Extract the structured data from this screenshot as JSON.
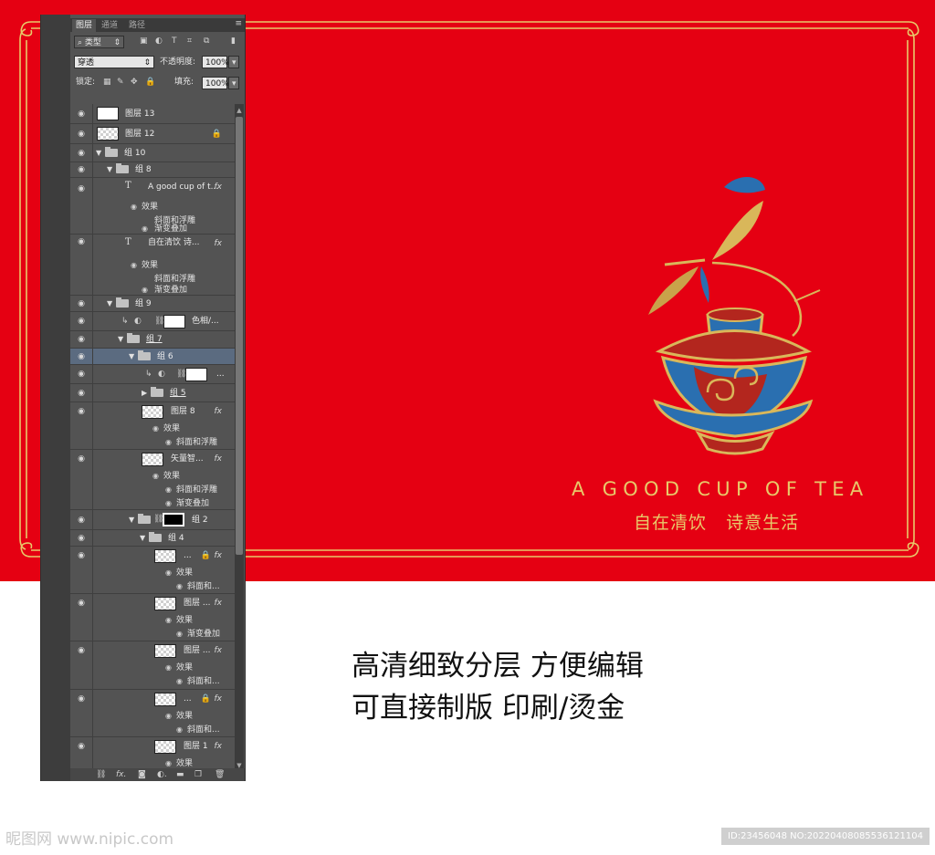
{
  "layers_panel": {
    "tabs": [
      "图层",
      "通道",
      "路径"
    ],
    "filter_kind": "类型",
    "blend_mode": "穿透",
    "opacity_label": "不透明度:",
    "opacity_value": "100%",
    "lock_label": "锁定:",
    "fill_label": "填充:",
    "fill_value": "100%",
    "menu_glyph": "≡"
  },
  "layers": {
    "l13": "图层 13",
    "l12": "图层 12",
    "g10": "组 10",
    "g8": "组 8",
    "t1": "A good cup of t...",
    "effects": "效果",
    "bevel": "斜面和浮雕",
    "gradient": "渐变叠加",
    "t2": "自在清饮  诗...",
    "g9": "组 9",
    "hue": "色相/...",
    "g7": "组 7",
    "g6": "组 6",
    "adj2": "...",
    "g5": "组 5",
    "l8": "图层 8",
    "smart": "矢量智...",
    "g2": "组 2",
    "g4": "组 4",
    "e1": "...",
    "bevel_short": "斜面和...",
    "l_dots1": "图层 ...",
    "l_dots2": "图层 ...",
    "e4": "...",
    "l1": "图层 1",
    "fx": "fx"
  },
  "artwork": {
    "slogan_en": "A GOOD CUP OF TEA",
    "slogan_cn": "自在清饮   诗意生活",
    "colors": {
      "background": "#e50012",
      "gold": "#e8c96a",
      "teacup_blue": "#2a6fb0",
      "teacup_red": "#b3261e"
    }
  },
  "caption": {
    "line1": "高清细致分层 方便编辑",
    "line2": "可直接制版 印刷/烫金"
  },
  "watermark": {
    "left": "昵图网 www.nipic.com",
    "right": "ID:23456048 NO:20220408085536121104"
  }
}
